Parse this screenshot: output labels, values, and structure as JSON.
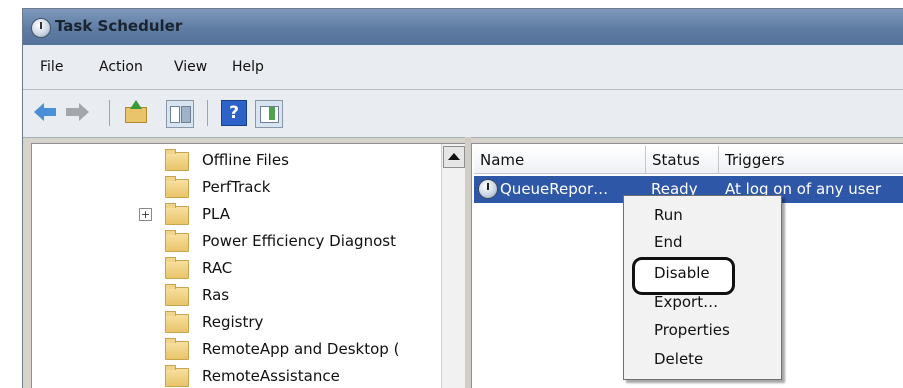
{
  "window": {
    "title": "Task Scheduler"
  },
  "menu": {
    "items": [
      "File",
      "Action",
      "View",
      "Help"
    ]
  },
  "toolbar": {
    "back": "back-arrow-icon",
    "forward": "forward-arrow-icon",
    "up": "up-folder-icon",
    "show_hide_tree": "console-tree-icon",
    "help": "?",
    "show_hide_action": "action-pane-icon"
  },
  "tree": {
    "items": [
      {
        "label": "Offline Files",
        "expandable": false
      },
      {
        "label": "PerfTrack",
        "expandable": false
      },
      {
        "label": "PLA",
        "expandable": true,
        "expander": "+"
      },
      {
        "label": "Power Efficiency Diagnost",
        "expandable": false
      },
      {
        "label": "RAC",
        "expandable": false
      },
      {
        "label": "Ras",
        "expandable": false
      },
      {
        "label": "Registry",
        "expandable": false
      },
      {
        "label": "RemoteApp and Desktop (",
        "expandable": false
      },
      {
        "label": "RemoteAssistance",
        "expandable": false
      }
    ]
  },
  "task_list": {
    "columns": [
      "Name",
      "Status",
      "Triggers"
    ],
    "rows": [
      {
        "name": "QueueRepor…",
        "status": "Ready",
        "triggers": "At log on of any user",
        "selected": true
      }
    ]
  },
  "context_menu": {
    "items": [
      "Run",
      "End",
      "Disable",
      "Export…",
      "Properties",
      "Delete"
    ],
    "highlighted": "Disable"
  },
  "colors": {
    "selection": "#2f57a8",
    "titlebar": "#5f7ca3",
    "highlight_ring": "#111111"
  }
}
